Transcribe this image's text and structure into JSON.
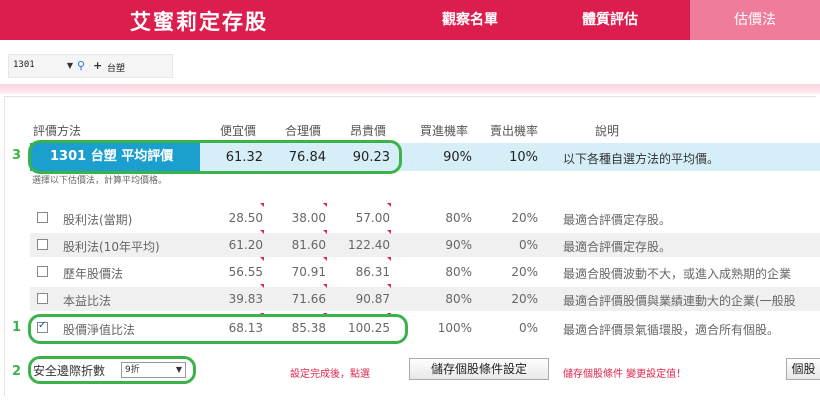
{
  "brand": "艾蜜莉定存股",
  "nav": {
    "watchlist": "觀察名單",
    "fitness": "體質評估",
    "valuation": "估價法"
  },
  "stock_picker": {
    "code": "1301",
    "name": "台塑",
    "dropdown_icon": "caret-down",
    "search_icon": "magnifier",
    "add_icon": "plus"
  },
  "table": {
    "headers": {
      "method": "評價方法",
      "cheap": "便宜價",
      "fair": "合理價",
      "expensive": "昂貴價",
      "buy_prob": "買進機率",
      "sell_prob": "賣出機率",
      "desc": "說明"
    },
    "average": {
      "name": "1301 台塑  平均評價",
      "cheap": "61.32",
      "fair": "76.84",
      "expensive": "90.23",
      "buy_prob": "90%",
      "sell_prob": "10%",
      "desc": "以下各種自選方法的平均價。"
    },
    "hint": "選擇以下估價法，計算平均價格。",
    "rows": [
      {
        "name": "股利法(當期)",
        "checked": false,
        "cheap": "28.50",
        "fair": "38.00",
        "expensive": "57.00",
        "buy_prob": "80%",
        "sell_prob": "20%",
        "desc": "最適合評價定存股。"
      },
      {
        "name": "股利法(10年平均)",
        "checked": false,
        "cheap": "61.20",
        "fair": "81.60",
        "expensive": "122.40",
        "buy_prob": "90%",
        "sell_prob": "0%",
        "desc": "最適合評價定存股。"
      },
      {
        "name": "歷年股價法",
        "checked": false,
        "cheap": "56.55",
        "fair": "70.91",
        "expensive": "86.31",
        "buy_prob": "80%",
        "sell_prob": "20%",
        "desc": "最適合股價波動不大，或進入成熟期的企業"
      },
      {
        "name": "本益比法",
        "checked": false,
        "cheap": "39.83",
        "fair": "71.66",
        "expensive": "90.87",
        "buy_prob": "80%",
        "sell_prob": "20%",
        "desc": "最適合評價股價與業績連動大的企業(一般股"
      },
      {
        "name": "股價淨值比法",
        "checked": true,
        "cheap": "68.13",
        "fair": "85.38",
        "expensive": "100.25",
        "buy_prob": "100%",
        "sell_prob": "0%",
        "desc": "最適合評價景氣循環股，適合所有個股。"
      }
    ]
  },
  "footer": {
    "safety_label": "安全邊際折數",
    "safety_value": "9折",
    "note1": "設定完成後，點選",
    "save_button": "儲存個股條件設定",
    "note2": "儲存個股條件 變更設定值！",
    "right_button": "個股"
  },
  "annotations": {
    "a1": "1",
    "a2": "2",
    "a3": "3"
  },
  "colors": {
    "brand_red": "#dc1e4e",
    "active_tab": "#f07c9c",
    "highlight_blue": "#1b9fcf",
    "annotation_green": "#3cb34a"
  }
}
